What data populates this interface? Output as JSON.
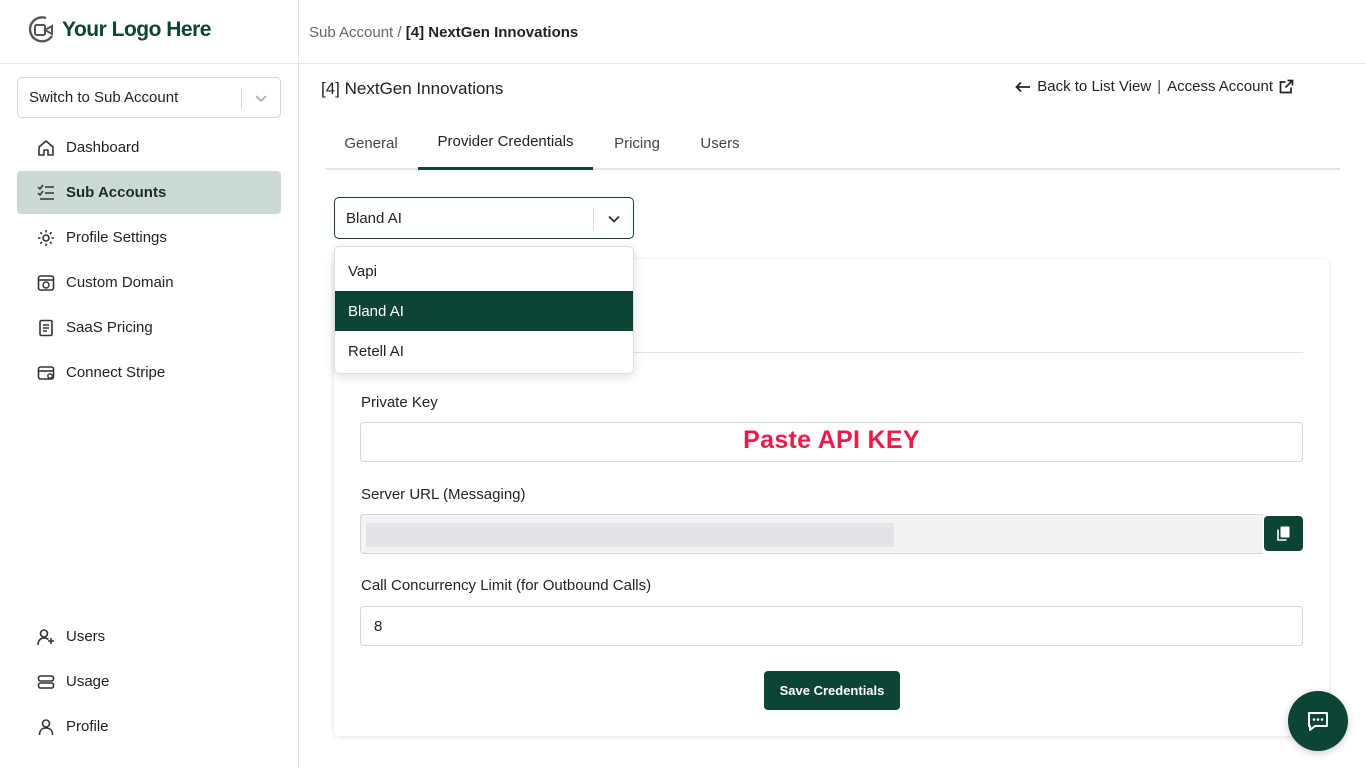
{
  "logo": {
    "text": "Your Logo Here"
  },
  "header": {
    "breadcrumb_parent": "Sub Account /",
    "breadcrumb_current": "[4] NextGen Innovations"
  },
  "sidebar": {
    "switch_placeholder": "Switch to Sub Account",
    "items": [
      {
        "label": "Dashboard",
        "icon": "home-icon"
      },
      {
        "label": "Sub Accounts",
        "icon": "checklist-icon",
        "active": true
      },
      {
        "label": "Profile Settings",
        "icon": "gear-icon"
      },
      {
        "label": "Custom Domain",
        "icon": "domain-icon"
      },
      {
        "label": "SaaS Pricing",
        "icon": "receipt-icon"
      },
      {
        "label": "Connect Stripe",
        "icon": "wallet-icon"
      }
    ],
    "bottom_items": [
      {
        "label": "Users",
        "icon": "user-plus-icon"
      },
      {
        "label": "Usage",
        "icon": "server-icon"
      },
      {
        "label": "Profile",
        "icon": "user-icon"
      }
    ]
  },
  "main": {
    "title": "[4] NextGen Innovations",
    "back_link": "Back to List View",
    "separator": "|",
    "access_link": "Access Account",
    "tabs": [
      {
        "label": "General"
      },
      {
        "label": "Provider Credentials",
        "active": true
      },
      {
        "label": "Pricing"
      },
      {
        "label": "Users"
      }
    ],
    "provider": {
      "selected": "Bland AI",
      "options": [
        "Vapi",
        "Bland AI",
        "Retell AI"
      ]
    },
    "form": {
      "private_key_label": "Private Key",
      "private_key_hint": "Paste API KEY",
      "server_url_label": "Server URL (Messaging)",
      "concurrency_label": "Call Concurrency Limit (for Outbound Calls)",
      "concurrency_value": "8",
      "save_label": "Save Credentials"
    }
  },
  "colors": {
    "brand": "#0d4436",
    "active_nav_bg": "#cbd9d3",
    "hint_red": "#ea1d4a"
  }
}
